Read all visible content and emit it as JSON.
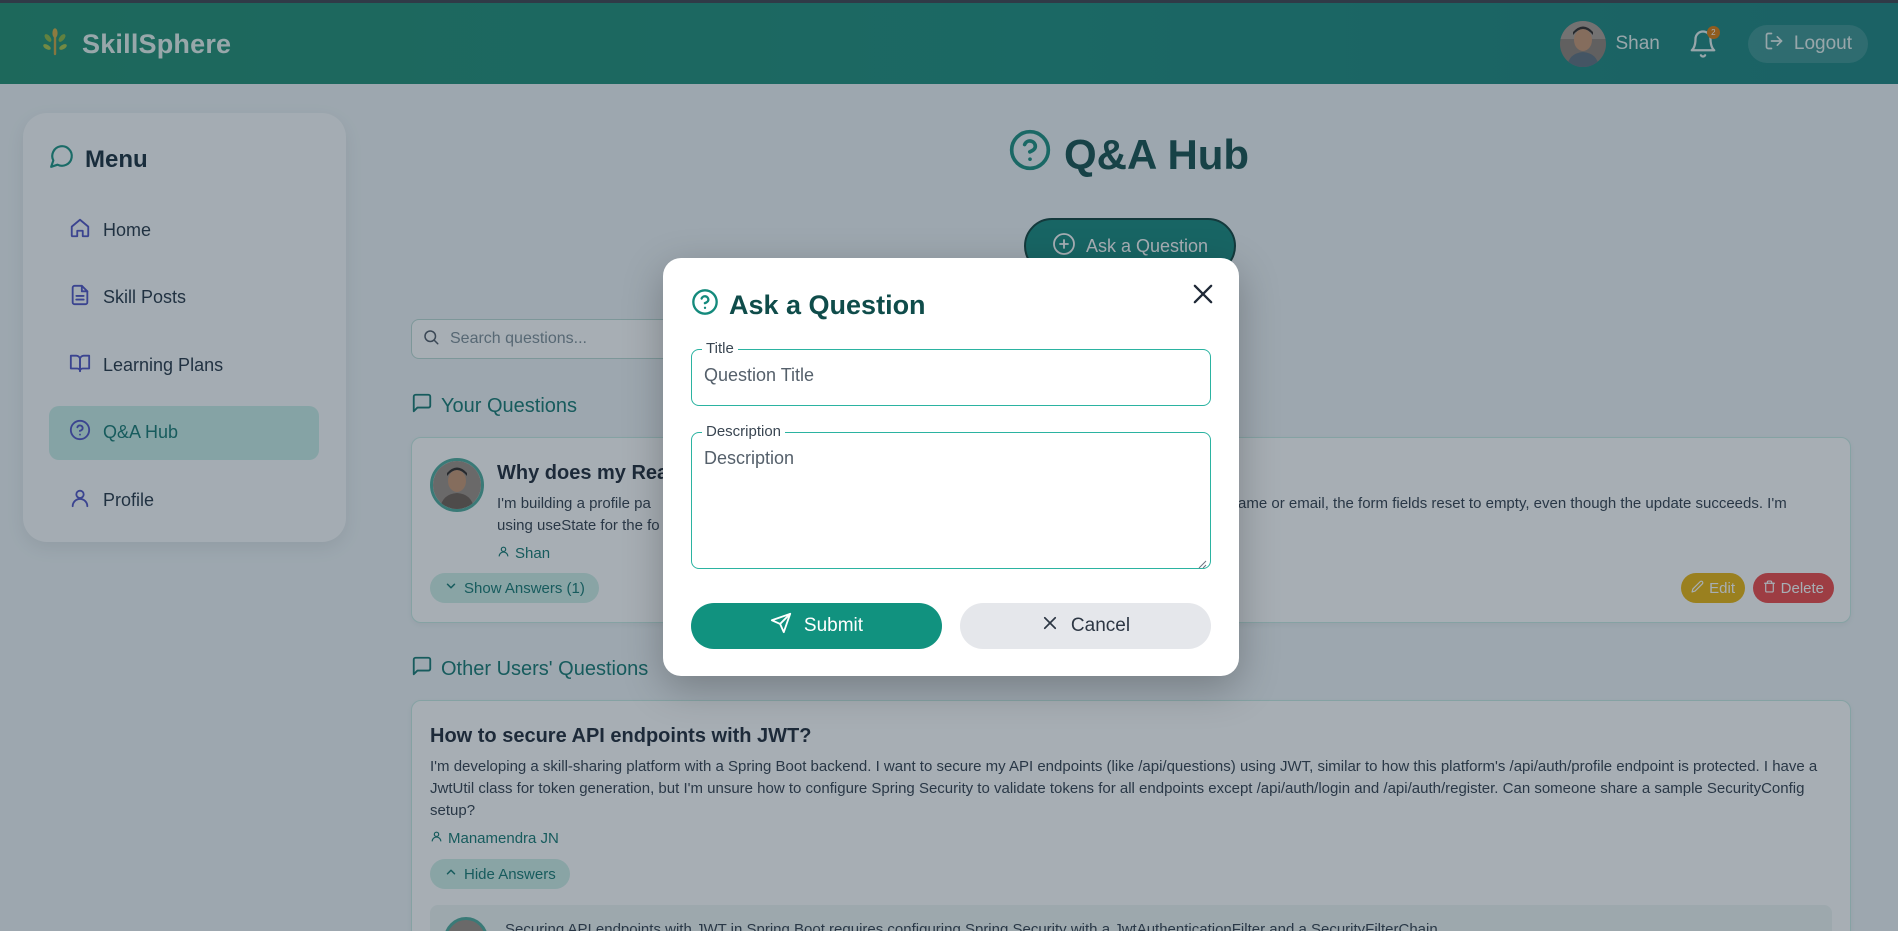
{
  "header": {
    "brand": "SkillSphere",
    "user_name": "Shan",
    "notification_count": "2",
    "logout_label": "Logout"
  },
  "sidebar": {
    "title": "Menu",
    "items": [
      {
        "label": "Home",
        "icon": "home-icon"
      },
      {
        "label": "Skill Posts",
        "icon": "document-icon"
      },
      {
        "label": "Learning Plans",
        "icon": "book-icon"
      },
      {
        "label": "Q&A Hub",
        "icon": "question-circle-icon",
        "active": true
      },
      {
        "label": "Profile",
        "icon": "user-icon"
      }
    ]
  },
  "main": {
    "title": "Q&A Hub",
    "ask_button": "Ask a Question",
    "search_placeholder": "Search questions...",
    "your_questions_heading": "Your Questions",
    "other_questions_heading": "Other Users' Questions"
  },
  "your_question": {
    "title": "Why does my Rea",
    "body_left_1": "I'm building a profile pa",
    "body_right_1": "ame or email, the form fields reset to empty, even though the update succeeds. I'm",
    "body_left_2": "using useState for the fo",
    "author": "Shan",
    "toggle_label": "Show Answers (1)",
    "edit_label": "Edit",
    "delete_label": "Delete"
  },
  "other_question": {
    "title": "How to secure API endpoints with JWT?",
    "body": "I'm developing a skill-sharing platform with a Spring Boot backend. I want to secure my API endpoints (like /api/questions) using JWT, similar to how this platform's /api/auth/profile endpoint is protected. I have a JwtUtil class for token generation, but I'm unsure how to configure Spring Security to validate tokens for all endpoints except /api/auth/login and /api/auth/register. Can someone share a sample SecurityConfig setup?",
    "author": "Manamendra JN",
    "toggle_label": "Hide Answers",
    "answer_preview": "Securing API endpoints with JWT in Spring Boot requires configuring Spring Security with a JwtAuthenticationFilter and a SecurityFilterChain."
  },
  "modal": {
    "title": "Ask a Question",
    "title_field_label": "Title",
    "title_placeholder": "Question Title",
    "description_field_label": "Description",
    "description_placeholder": "Description",
    "submit_label": "Submit",
    "cancel_label": "Cancel"
  },
  "colors": {
    "accent": "#0f766e",
    "header": "#178a7a",
    "submit": "#11927f",
    "edit": "#eab308",
    "delete": "#ef4444"
  }
}
